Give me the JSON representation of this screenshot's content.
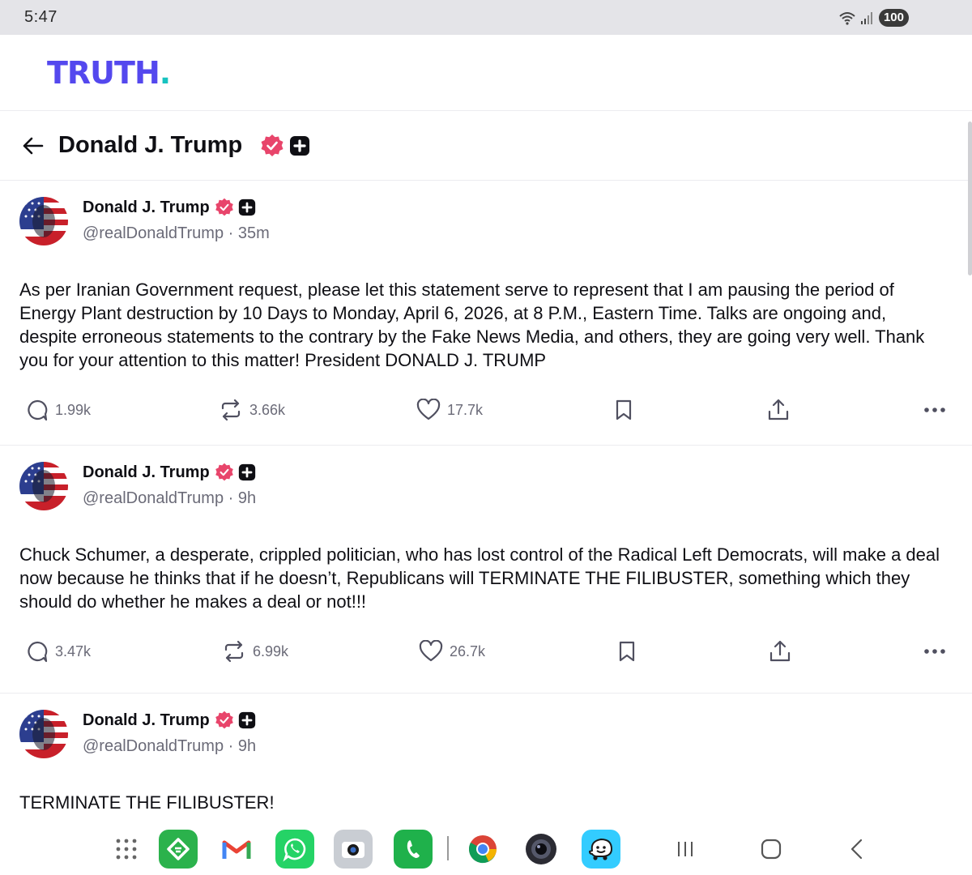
{
  "status_bar": {
    "time": "5:47",
    "battery": "100"
  },
  "app": {
    "logo_text": "TRUTH",
    "logo_dot": "."
  },
  "profile_header": {
    "name": "Donald J. Trump"
  },
  "posts": [
    {
      "name": "Donald J. Trump",
      "handle": "@realDonaldTrump",
      "time": "· 35m",
      "text": "As per Iranian Government request, please let this statement serve to represent that I am pausing the period of Energy Plant destruction by 10 Days to Monday, April 6, 2026, at 8 P.M., Eastern Time. Talks are ongoing and, despite erroneous statements to the contrary by the Fake News Media, and others, they are going very well. Thank you for your attention to this matter! President DONALD J. TRUMP",
      "replies": "1.99k",
      "retruths": "3.66k",
      "likes": "17.7k"
    },
    {
      "name": "Donald J. Trump",
      "handle": "@realDonaldTrump",
      "time": "· 9h",
      "text": "Chuck Schumer, a desperate, crippled politician, who has lost control of the Radical Left Democrats, will make a deal now because he thinks that if he doesn’t, Republicans will TERMINATE THE FILIBUSTER, something which they should do whether he makes a deal or not!!!",
      "replies": "3.47k",
      "retruths": "6.99k",
      "likes": "26.7k"
    },
    {
      "name": "Donald J. Trump",
      "handle": "@realDonaldTrump",
      "time": "· 9h",
      "text": "TERMINATE THE FILIBUSTER!"
    }
  ],
  "colors": {
    "brand": "#5448ee",
    "brand_dot": "#17c3c0",
    "verified": "#e8456b",
    "muted": "#6b6b78"
  },
  "dock": {
    "apps": [
      "app-drawer-icon",
      "feedly-icon",
      "gmail-icon",
      "whatsapp-icon",
      "camera-icon",
      "phone-icon",
      "chrome-icon",
      "camera-lens-icon",
      "waze-icon"
    ],
    "nav": [
      "recents-icon",
      "home-icon",
      "back-icon"
    ]
  }
}
